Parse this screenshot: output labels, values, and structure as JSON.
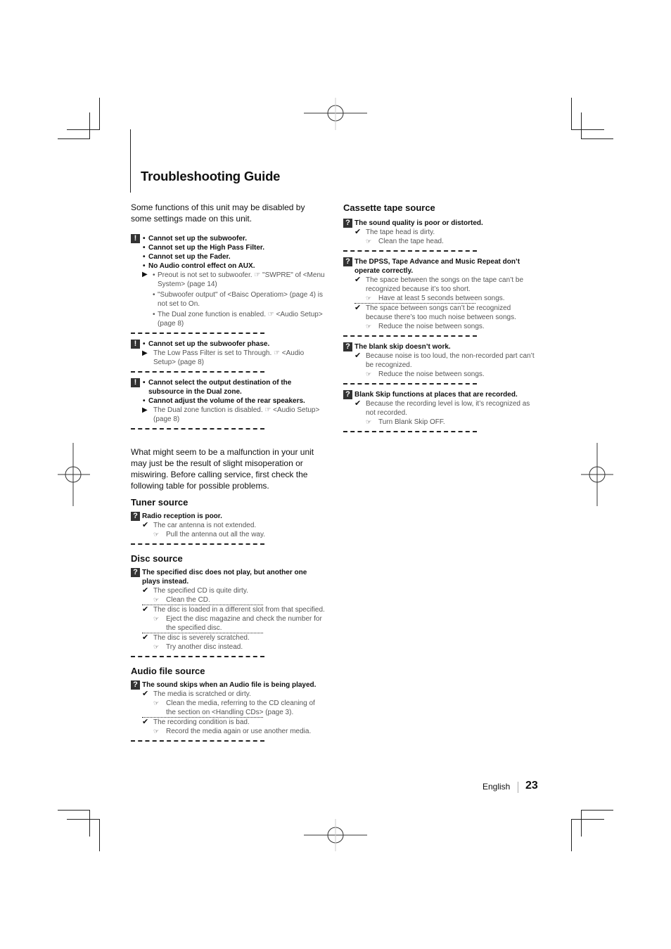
{
  "page_title": "Troubleshooting Guide",
  "intro_disabled": "Some functions of this unit may be disabled by some settings made on this unit.",
  "disabled_blocks": [
    {
      "icon": "exclamation-icon",
      "titles": [
        "Cannot set up the subwoofer.",
        "Cannot set up the High Pass Filter.",
        "Cannot set up the Fader.",
        "No Audio control effect on AUX."
      ],
      "causes": [
        "Preout is not set to subwoofer. ☞ \"SWPRE\" of <Menu System> (page 14)",
        "\"Subwoofer output\" of <Baisc Operatiom> (page 4) is not set to On.",
        "The Dual zone function is enabled. ☞ <Audio Setup> (page 8)"
      ]
    },
    {
      "icon": "exclamation-icon",
      "titles": [
        "Cannot set up the subwoofer phase."
      ],
      "causes": [
        "The Low Pass Filter is set to Through. ☞ <Audio Setup> (page 8)"
      ]
    },
    {
      "icon": "exclamation-icon",
      "titles": [
        "Cannot select the output destination of the subsource in the Dual zone.",
        "Cannot adjust the volume of the rear speakers."
      ],
      "causes": [
        "The Dual zone function is disabled. ☞ <Audio Setup> (page 8)"
      ]
    }
  ],
  "intro_malfunction": "What might seem to be a malfunction in your unit may just be the result of slight misoperation or miswiring. Before calling service, first check the following table for possible problems.",
  "sections": {
    "tuner": {
      "heading": "Tuner source",
      "problems": [
        {
          "title": "Radio reception is poor.",
          "causes": [
            {
              "cause": "The car antenna is not extended.",
              "fix": "Pull the antenna out all the way."
            }
          ]
        }
      ]
    },
    "disc": {
      "heading": "Disc source",
      "problems": [
        {
          "title": "The specified disc does not play, but another one plays instead.",
          "causes": [
            {
              "cause": "The specified CD is quite dirty.",
              "fix": "Clean the CD."
            },
            {
              "cause": "The disc is loaded in a different slot from that specified.",
              "fix": "Eject the disc magazine and check the number for the specified disc."
            },
            {
              "cause": "The disc is severely scratched.",
              "fix": "Try another disc instead."
            }
          ]
        }
      ]
    },
    "audio_file": {
      "heading": "Audio file source",
      "problems": [
        {
          "title": "The sound skips when an Audio file is being played.",
          "causes": [
            {
              "cause": "The media is scratched or dirty.",
              "fix": "Clean the media, referring to the CD cleaning of the section on <Handling CDs> (page 3)."
            },
            {
              "cause": "The recording condition is bad.",
              "fix": "Record the media again or use another media."
            }
          ]
        }
      ]
    },
    "cassette": {
      "heading": "Cassette tape source",
      "problems": [
        {
          "title": "The sound quality is poor or distorted.",
          "causes": [
            {
              "cause": "The tape head is dirty.",
              "fix": "Clean the tape head."
            }
          ]
        },
        {
          "title": "The DPSS, Tape Advance and Music Repeat don’t operate correctly.",
          "causes": [
            {
              "cause": "The space between the songs on the tape can’t be recognized because it’s too short.",
              "fix": "Have at least 5 seconds between songs."
            },
            {
              "cause": "The space between songs can’t be recognized because there’s too much noise between songs.",
              "fix": "Reduce the noise between songs."
            }
          ]
        },
        {
          "title": "The blank skip doesn’t work.",
          "causes": [
            {
              "cause": "Because noise is too loud, the non-recorded part can’t be recognized.",
              "fix": "Reduce the noise between songs."
            }
          ]
        },
        {
          "title": "Blank Skip functions at places that are recorded.",
          "causes": [
            {
              "cause": "Because the recording level is low, it’s recognized as not recorded.",
              "fix": "Turn Blank Skip OFF."
            }
          ]
        }
      ]
    }
  },
  "icons": {
    "exclamation": "!",
    "question": "?",
    "arrow": "▶",
    "check": "✔",
    "hand": "☞"
  },
  "footer": {
    "language": "English",
    "page_number": "23"
  }
}
